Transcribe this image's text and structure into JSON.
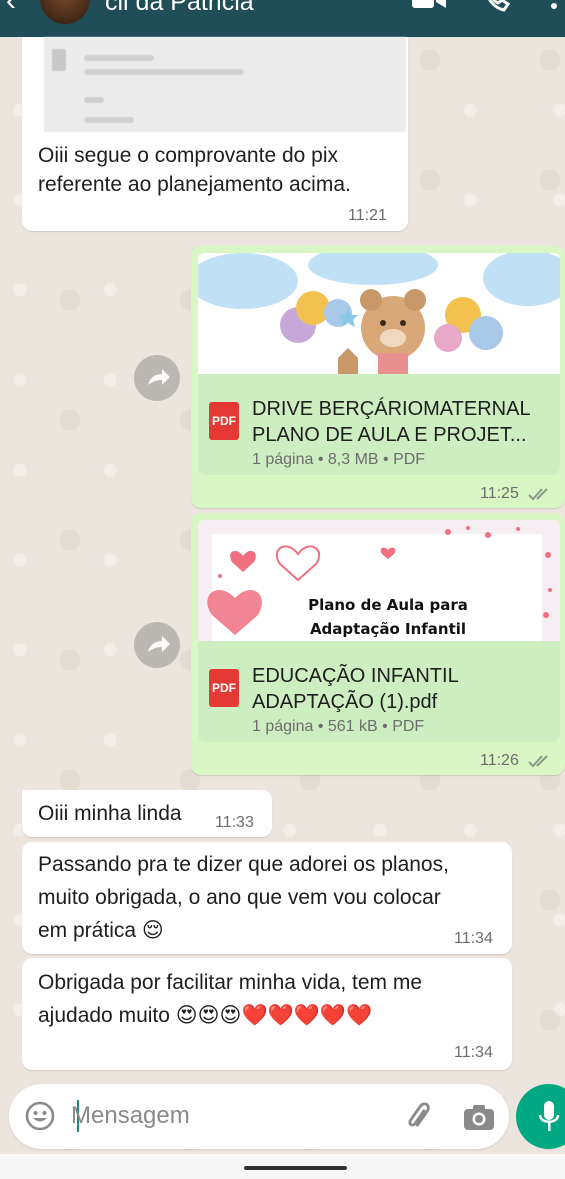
{
  "header": {
    "contact_name": "cli da Patricia",
    "back_icon": "arrow-back-icon",
    "video_icon": "video-call-icon",
    "call_icon": "phone-icon",
    "menu_icon": "more-vert-icon"
  },
  "messages": [
    {
      "id": "m1",
      "direction": "incoming",
      "text_lines": [
        "Oiii segue o comprovante do pix",
        "referente ao planejamento acima."
      ],
      "time": "11:21"
    },
    {
      "id": "m2",
      "direction": "outgoing",
      "type": "document",
      "name_lines": [
        "DRIVE BERÇÁRIOMATERNAL",
        "PLANO DE AULA E PROJET..."
      ],
      "meta": "1 página • 8,3 MB • PDF",
      "time": "11:25",
      "status": "read"
    },
    {
      "id": "m3",
      "direction": "outgoing",
      "type": "document",
      "thumbnail_text_lines": [
        "Plano de Aula para",
        "Adaptação Infantil"
      ],
      "name_lines": [
        "EDUCAÇÃO INFANTIL",
        "ADAPTAÇÃO (1).pdf"
      ],
      "meta": "1 página • 561 kB • PDF",
      "time": "11:26",
      "status": "read"
    },
    {
      "id": "m4",
      "direction": "incoming",
      "text": "Oiii minha linda",
      "time": "11:33"
    },
    {
      "id": "m5",
      "direction": "incoming",
      "text_lines": [
        "Passando pra te dizer que adorei os planos,",
        "muito obrigada, o ano que vem vou colocar",
        "em prática 😌"
      ],
      "time": "11:34"
    },
    {
      "id": "m6",
      "direction": "incoming",
      "text_lines": [
        "Obrigada por facilitar minha vida, tem me",
        "ajudado muito 😍😍😍❤️❤️❤️❤️❤️"
      ],
      "time": "11:34"
    }
  ],
  "pdf_badge": "PDF",
  "composer": {
    "placeholder": "Mensagem",
    "emoji_icon": "emoji-icon",
    "attach_icon": "paperclip-icon",
    "camera_icon": "camera-icon",
    "mic_icon": "microphone-icon"
  },
  "colors": {
    "header": "#1f4e58",
    "outgoing_bubble": "#d9f7c4",
    "incoming_bubble": "#ffffff",
    "accent": "#00a884",
    "read_ticks": "#8a9a8a"
  }
}
